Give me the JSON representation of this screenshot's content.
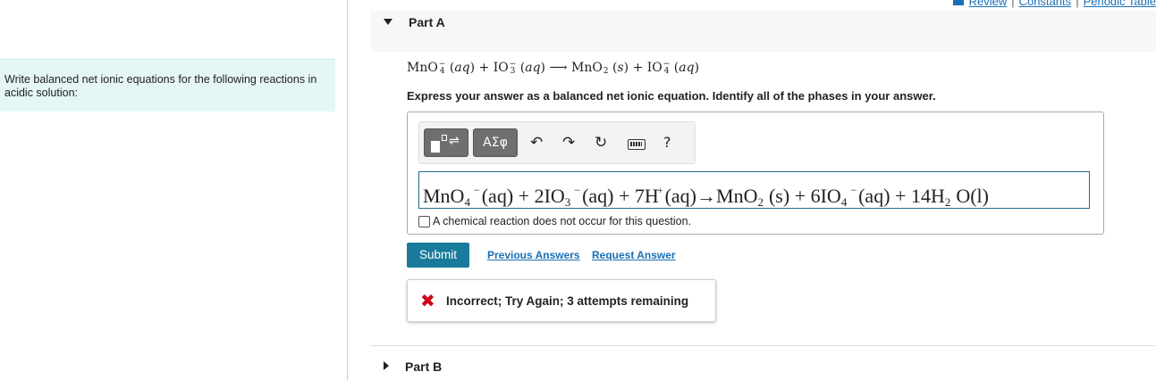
{
  "top_links": {
    "review": "Review",
    "constants": "Constants",
    "periodic_table": "Periodic Table",
    "separator": "|"
  },
  "left_panel": {
    "text": "Write balanced net ionic equations for the following reactions in acidic solution:"
  },
  "part_a": {
    "title": "Part A",
    "reaction": {
      "r1": "MnO",
      "r1_sub": "4",
      "r1_sup": "−",
      "phase1": "aq",
      "plus1": "+",
      "r2": "IO",
      "r2_sub": "3",
      "r2_sup": "−",
      "phase2": "aq",
      "arrow": "⟶",
      "p1": "MnO",
      "p1_sub": "2",
      "phase3": "s",
      "plus2": "+",
      "p2": "IO",
      "p2_sub": "4",
      "p2_sup": "−",
      "phase4": "aq"
    },
    "instruction": "Express your answer as a balanced net ionic equation. Identify all of the phases in your answer.",
    "toolbar": {
      "templates_arrow": "⇌",
      "greek": "AΣφ",
      "undo": "↶",
      "redo": "↷",
      "reset": "↻",
      "help": "?",
      "icons": [
        "templates-icon",
        "greek-letters-icon",
        "undo-icon",
        "redo-icon",
        "reset-icon",
        "keyboard-icon",
        "help-icon"
      ]
    },
    "answer": {
      "a1": "MnO",
      "a1_sub": "4",
      "a1_sup": "−",
      "a1_phase": "(aq)",
      "plus1": "+",
      "a2_coef": "2IO",
      "a2_sub": "3",
      "a2_sup": "−",
      "a2_phase": "(aq)",
      "plus2": "+",
      "a3": "7H",
      "a3_sup": "+",
      "a3_phase": "(aq)",
      "arrow": "→",
      "a4": "MnO",
      "a4_sub": "2",
      "a4_phase": "(s)",
      "plus3": "+",
      "a5": "6IO",
      "a5_sub": "4",
      "a5_sup": "−",
      "a5_phase": "(aq)",
      "plus4": "+",
      "a6": "14H",
      "a6_sub": "2",
      "a6_tail": "O(l)"
    },
    "no_reaction_label": "A chemical reaction does not occur for this question.",
    "submit_label": "Submit",
    "previous_answers_label": "Previous Answers",
    "request_answer_label": "Request Answer",
    "feedback": "Incorrect; Try Again; 3 attempts remaining",
    "feedback_icon": "✖",
    "colors": {
      "submit_bg": "#1a7a9b",
      "link": "#1a6fb5",
      "error": "#d0021b",
      "panel_bg": "#e5f6f6"
    }
  },
  "part_b": {
    "title": "Part B"
  }
}
